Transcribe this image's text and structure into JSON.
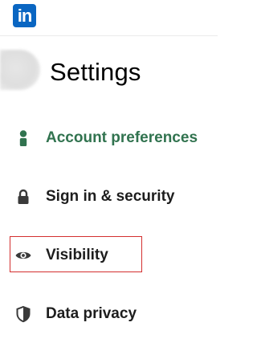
{
  "header": {
    "logo_text": "in",
    "brand_color": "#0a66c2"
  },
  "profile": {
    "avatar_icon": "blurred-avatar"
  },
  "page": {
    "title": "Settings"
  },
  "nav": {
    "items": [
      {
        "label": "Account preferences",
        "icon": "person-icon",
        "active": true,
        "color": "#31734f"
      },
      {
        "label": "Sign in & security",
        "icon": "lock-icon",
        "active": false
      },
      {
        "label": "Visibility",
        "icon": "eye-icon",
        "active": false,
        "highlighted": true
      },
      {
        "label": "Data privacy",
        "icon": "shield-icon",
        "active": false
      }
    ]
  },
  "annotation": {
    "highlight_color": "#d32f2f"
  }
}
